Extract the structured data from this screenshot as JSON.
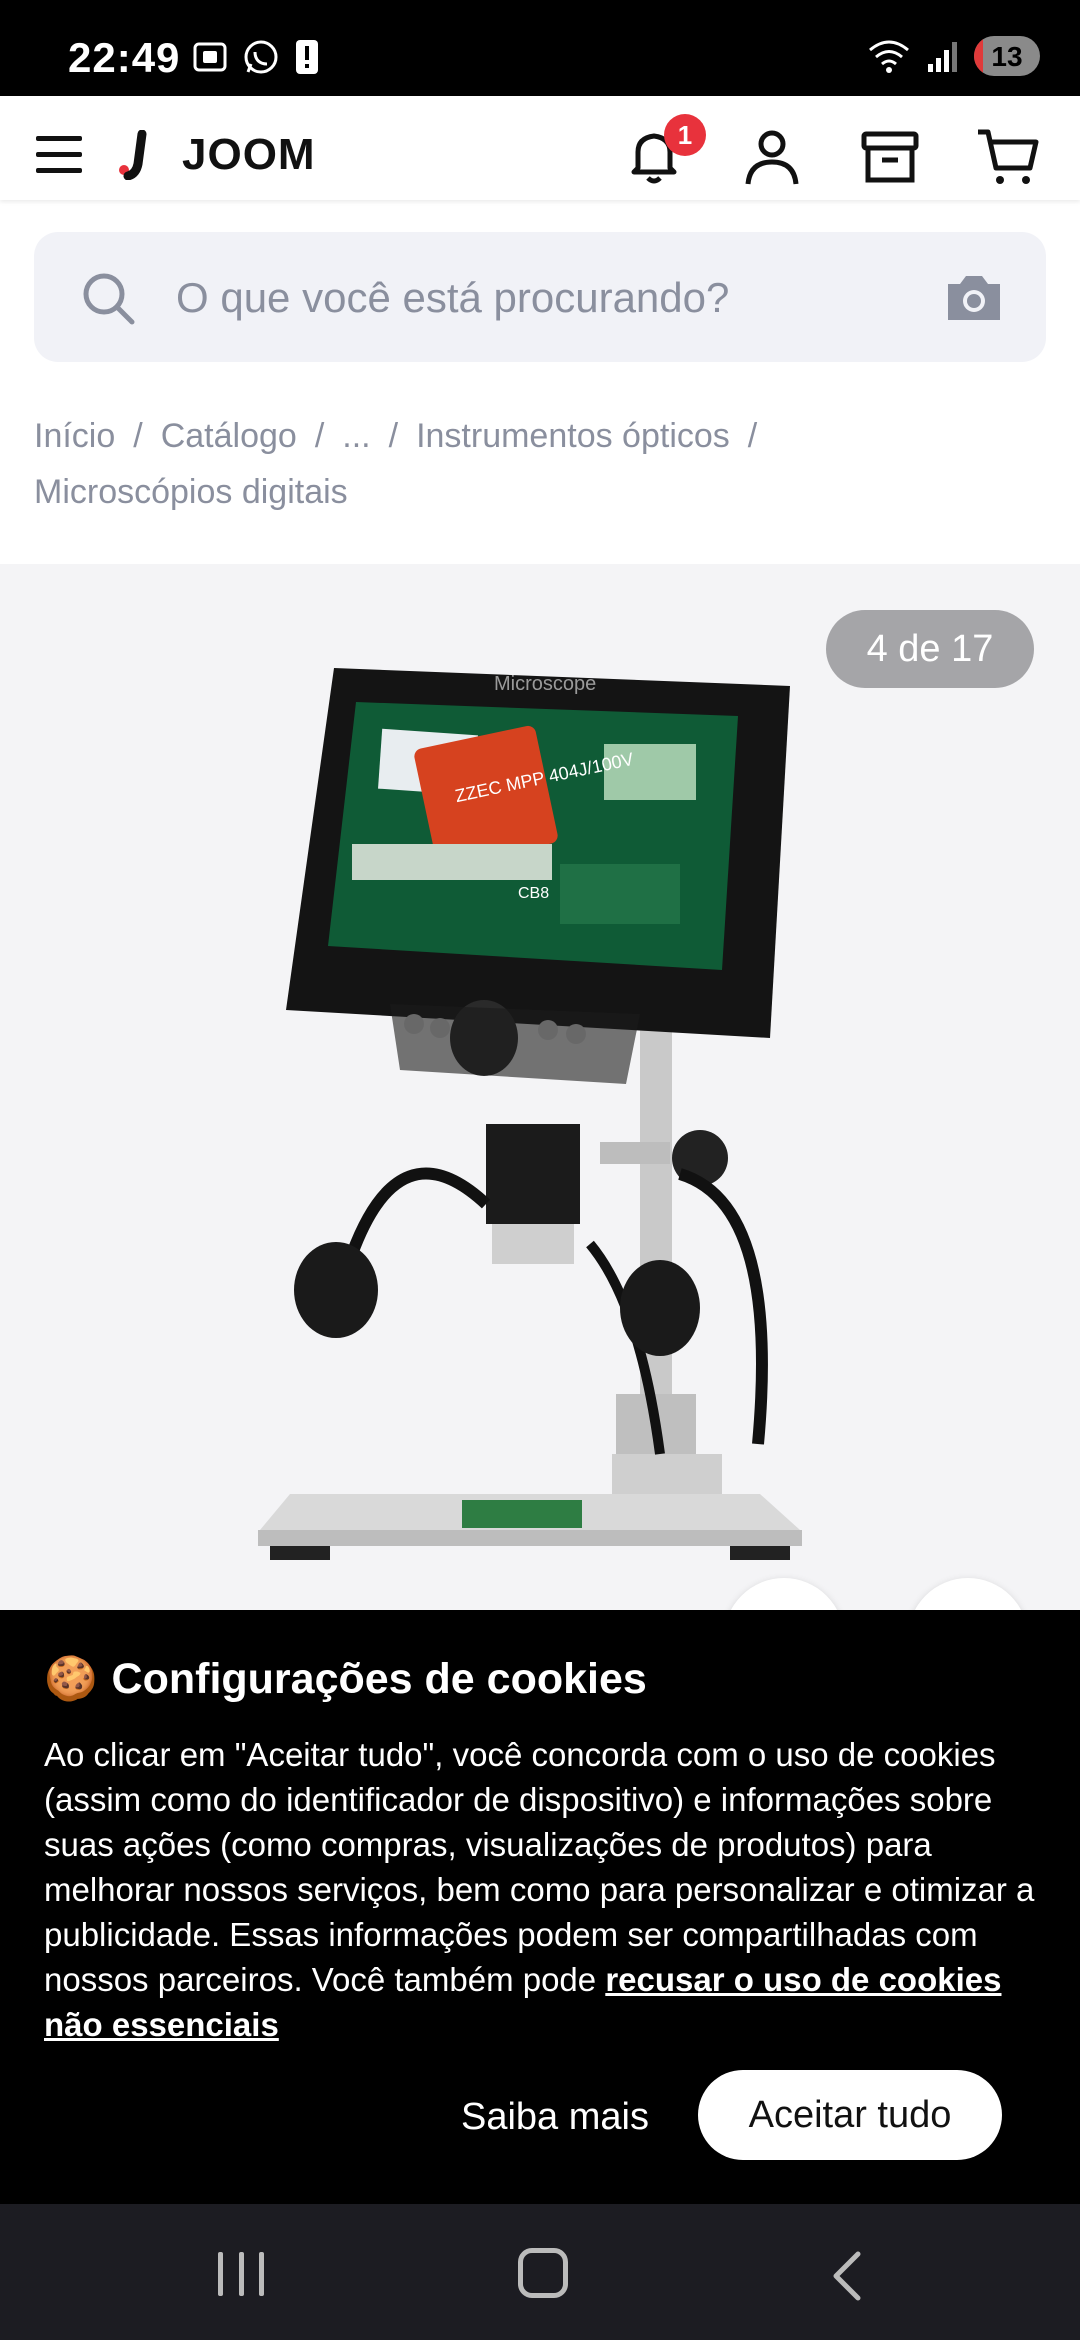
{
  "status_bar": {
    "time": "22:49",
    "battery": "13",
    "battery_level": 0.13,
    "left_icons": [
      "screenshot-icon",
      "whatsapp-icon",
      "alert-icon"
    ],
    "right_icons": [
      "wifi-icon",
      "signal-icon",
      "battery-icon"
    ]
  },
  "header": {
    "brand": "JOOM",
    "notification_count": "1",
    "icons": [
      "menu-icon",
      "bell-icon",
      "user-icon",
      "orders-icon",
      "cart-icon"
    ]
  },
  "search": {
    "placeholder": "O que você está procurando?"
  },
  "breadcrumb": {
    "items": [
      "Início",
      "Catálogo",
      "...",
      "Instrumentos ópticos",
      "Microscópios digitais"
    ],
    "separator": "/"
  },
  "gallery": {
    "counter": "4 de 17",
    "screen_label": "Microscope",
    "capacitor_text": "ZZEC MPP 404J/100V",
    "board_text": "CB8"
  },
  "cookie_banner": {
    "emoji": "🍪",
    "title": "Configurações de cookies",
    "body": "Ao clicar em \"Aceitar tudo\", você concorda com o uso de cookies (assim como do identificador de dispositivo) e informações sobre suas ações (como compras, visualizações de produtos) para melhorar nossos serviços, bem como para personalizar e otimizar a publicidade. Essas informações podem ser compartilhadas com nossos parceiros. Você também pode ",
    "link": "recusar o uso de cookies não essenciais",
    "learn_more": "Saiba mais",
    "accept_all": "Aceitar tudo"
  },
  "colors": {
    "accent": "#e8323c",
    "header_bg": "#ffffff",
    "search_bg": "#f1f2f7",
    "banner_bg": "#000000",
    "muted_text": "#8a8f9e"
  }
}
